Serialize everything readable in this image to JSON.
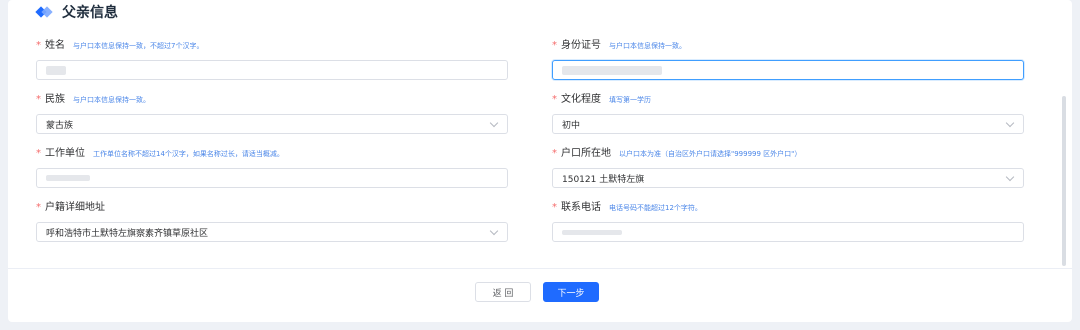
{
  "section": {
    "title": "父亲信息"
  },
  "fields": {
    "name": {
      "label": "姓名",
      "hint": "与户口本信息保持一致，不超过7个汉字。",
      "value": ""
    },
    "id_number": {
      "label": "身份证号",
      "hint": "与户口本信息保持一致。",
      "value": ""
    },
    "ethnicity": {
      "label": "民族",
      "hint": "与户口本信息保持一致。",
      "value": "蒙古族"
    },
    "education": {
      "label": "文化程度",
      "hint": "填写第一学历",
      "value": "初中"
    },
    "employer": {
      "label": "工作单位",
      "hint": "工作单位名称不超过14个汉字，如果名称过长，请适当概减。",
      "value": ""
    },
    "household_location": {
      "label": "户口所在地",
      "hint": "以户口本为准（自治区外户口请选择\"999999 区外户口\"）",
      "value": "150121 土默特左旗"
    },
    "household_address": {
      "label": "户籍详细地址",
      "hint": "",
      "value": "呼和浩特市土默特左旗察素齐镇草原社区"
    },
    "phone": {
      "label": "联系电话",
      "hint": "电话号码不能超过12个字符。",
      "value": ""
    }
  },
  "buttons": {
    "back": "返 回",
    "next": "下一步"
  }
}
